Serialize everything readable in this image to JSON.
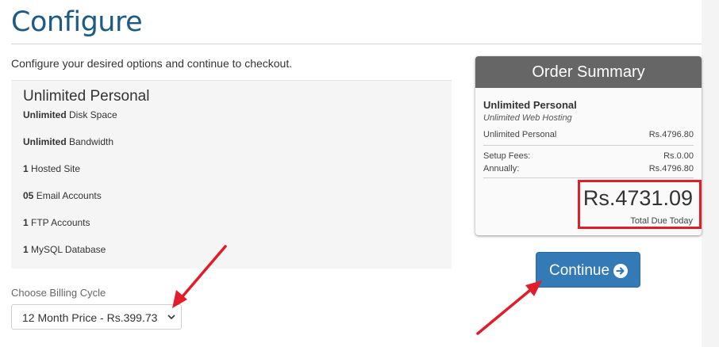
{
  "page": {
    "title": "Configure",
    "intro": "Configure your desired options and continue to checkout."
  },
  "product": {
    "name": "Unlimited Personal",
    "features": [
      {
        "bold": "Unlimited",
        "text": " Disk Space"
      },
      {
        "bold": "Unlimited",
        "text": " Bandwidth"
      },
      {
        "bold": "1",
        "text": " Hosted Site"
      },
      {
        "bold": "05",
        "text": " Email Accounts"
      },
      {
        "bold": "1",
        "text": " FTP Accounts"
      },
      {
        "bold": "1",
        "text": " MySQL Database"
      }
    ]
  },
  "billing": {
    "label": "Choose Billing Cycle",
    "selected": "12 Month Price - Rs.399.73"
  },
  "summary": {
    "header": "Order Summary",
    "product_name": "Unlimited Personal",
    "product_group": "Unlimited Web Hosting",
    "line_item": {
      "label": "Unlimited Personal",
      "amount": "Rs.4796.80"
    },
    "setup_fees": {
      "label": "Setup Fees:",
      "amount": "Rs.0.00"
    },
    "annually": {
      "label": "Annually:",
      "amount": "Rs.4796.80"
    },
    "total_amount": "Rs.4731.09",
    "total_label": "Total Due Today"
  },
  "actions": {
    "continue_label": "Continue"
  },
  "colors": {
    "title": "#1d5b84",
    "summary_header": "#666666",
    "button": "#337ab7",
    "annotation_red": "#e11d2b"
  }
}
